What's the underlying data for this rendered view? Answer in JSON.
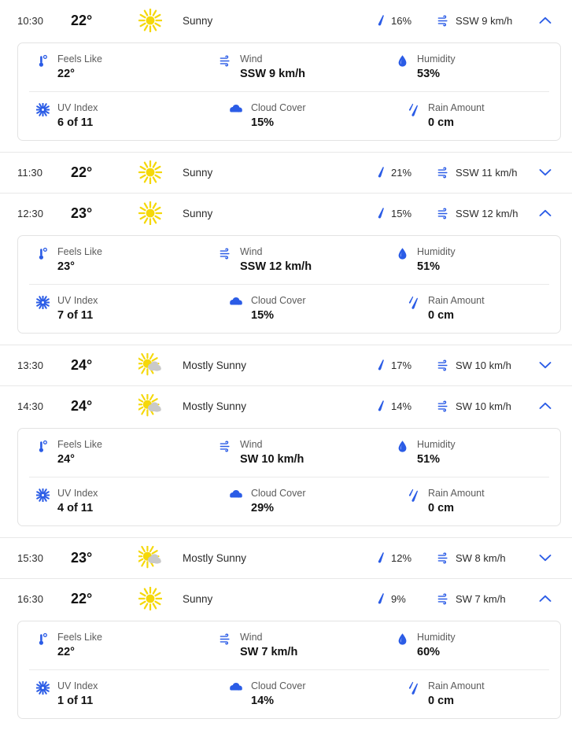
{
  "detail_labels": {
    "feels_like": "Feels Like",
    "wind": "Wind",
    "humidity": "Humidity",
    "uv_index": "UV Index",
    "cloud_cover": "Cloud Cover",
    "rain_amount": "Rain Amount"
  },
  "colors": {
    "accent_blue": "#2b5ce6",
    "sun_yellow": "#f5d80a",
    "cloud_gray": "#c9c9c9",
    "text": "#2b2b2b",
    "label": "#5b5b5b",
    "divider": "#e8e8e8"
  },
  "icons": {
    "sunny": "sun-icon",
    "mostly_sunny": "sun-behind-cloud-icon",
    "precip": "raindrop-icon",
    "wind": "wind-icon",
    "chevron_up": "chevron-up-icon",
    "chevron_down": "chevron-down-icon",
    "feels_like": "thermometer-icon",
    "humidity": "water-drop-icon",
    "uv_index": "uv-sun-icon",
    "cloud_cover": "cloud-icon",
    "rain_amount": "rain-icon"
  },
  "hours": [
    {
      "time": "10:30",
      "temp": "22°",
      "condition": "Sunny",
      "condition_icon": "sunny",
      "precip": "16%",
      "wind": "SSW 9 km/h",
      "expanded": true,
      "details": {
        "feels_like": "22°",
        "wind": "SSW 9 km/h",
        "humidity": "53%",
        "uv_index": "6 of 11",
        "cloud_cover": "15%",
        "rain_amount": "0 cm"
      }
    },
    {
      "time": "11:30",
      "temp": "22°",
      "condition": "Sunny",
      "condition_icon": "sunny",
      "precip": "21%",
      "wind": "SSW 11 km/h",
      "expanded": false,
      "details": null
    },
    {
      "time": "12:30",
      "temp": "23°",
      "condition": "Sunny",
      "condition_icon": "sunny",
      "precip": "15%",
      "wind": "SSW 12 km/h",
      "expanded": true,
      "details": {
        "feels_like": "23°",
        "wind": "SSW 12 km/h",
        "humidity": "51%",
        "uv_index": "7 of 11",
        "cloud_cover": "15%",
        "rain_amount": "0 cm"
      }
    },
    {
      "time": "13:30",
      "temp": "24°",
      "condition": "Mostly Sunny",
      "condition_icon": "mostly_sunny",
      "precip": "17%",
      "wind": "SW 10 km/h",
      "expanded": false,
      "details": null
    },
    {
      "time": "14:30",
      "temp": "24°",
      "condition": "Mostly Sunny",
      "condition_icon": "mostly_sunny",
      "precip": "14%",
      "wind": "SW 10 km/h",
      "expanded": true,
      "details": {
        "feels_like": "24°",
        "wind": "SW 10 km/h",
        "humidity": "51%",
        "uv_index": "4 of 11",
        "cloud_cover": "29%",
        "rain_amount": "0 cm"
      }
    },
    {
      "time": "15:30",
      "temp": "23°",
      "condition": "Mostly Sunny",
      "condition_icon": "mostly_sunny",
      "precip": "12%",
      "wind": "SW 8 km/h",
      "expanded": false,
      "details": null
    },
    {
      "time": "16:30",
      "temp": "22°",
      "condition": "Sunny",
      "condition_icon": "sunny",
      "precip": "9%",
      "wind": "SW 7 km/h",
      "expanded": true,
      "details": {
        "feels_like": "22°",
        "wind": "SW 7 km/h",
        "humidity": "60%",
        "uv_index": "1 of 11",
        "cloud_cover": "14%",
        "rain_amount": "0 cm"
      }
    }
  ]
}
